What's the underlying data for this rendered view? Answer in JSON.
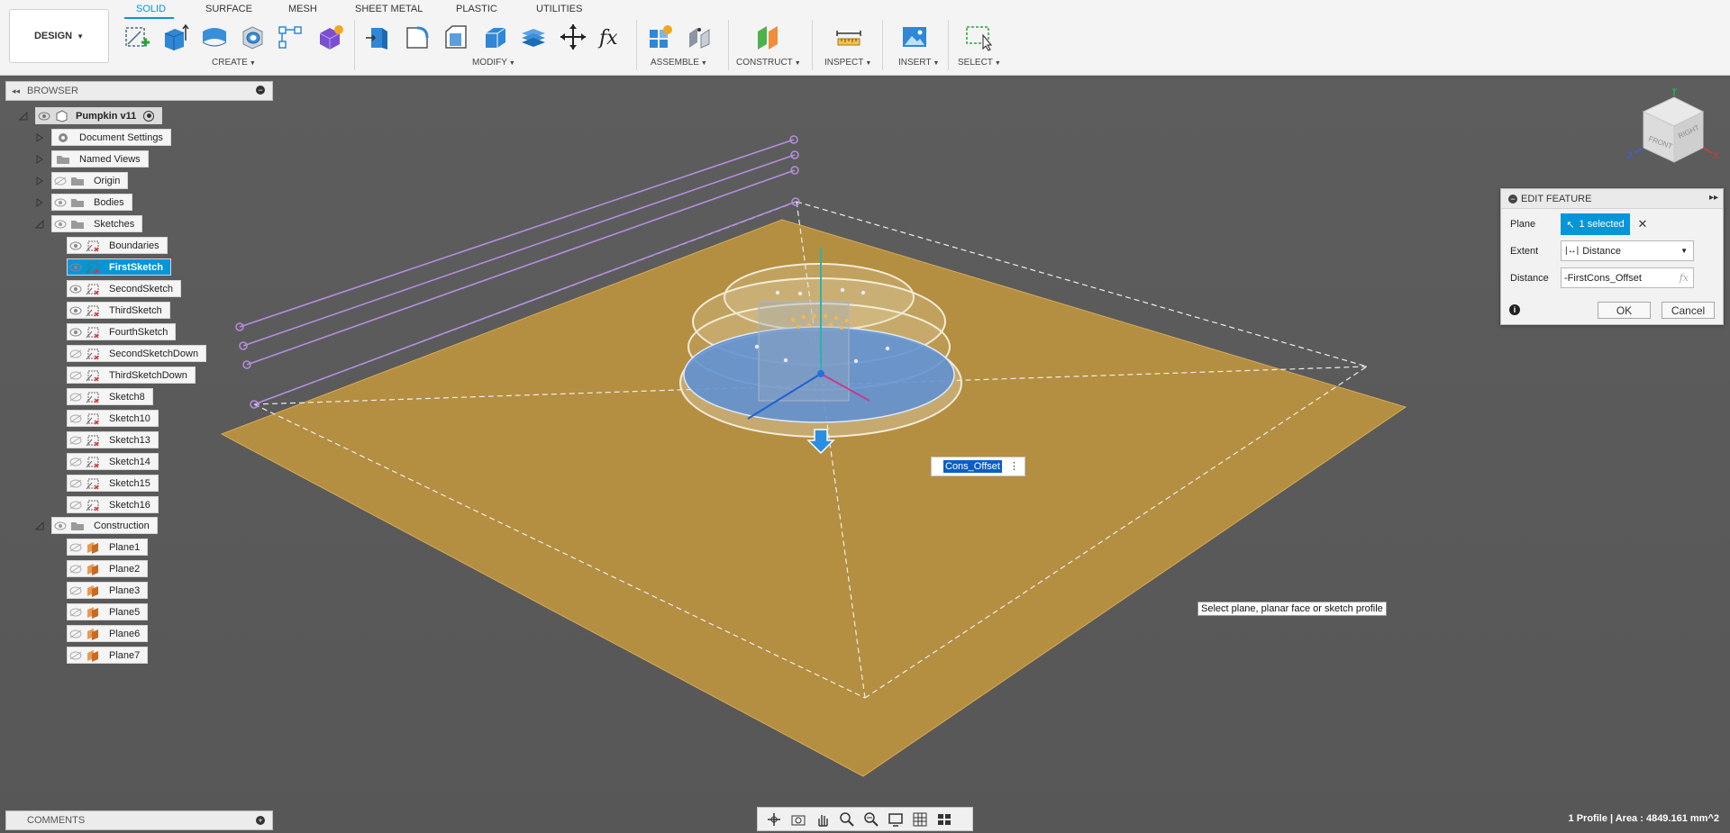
{
  "toolbar": {
    "workspace": "DESIGN",
    "tabs": [
      "SOLID",
      "SURFACE",
      "MESH",
      "SHEET METAL",
      "PLASTIC",
      "UTILITIES"
    ],
    "active_tab": "SOLID",
    "groups": {
      "create": "CREATE",
      "modify": "MODIFY",
      "assemble": "ASSEMBLE",
      "construct": "CONSTRUCT",
      "inspect": "INSPECT",
      "insert": "INSERT",
      "select": "SELECT"
    }
  },
  "browser": {
    "title": "BROWSER",
    "root": "Pumpkin v11",
    "items": [
      {
        "label": "Document Settings"
      },
      {
        "label": "Named Views"
      },
      {
        "label": "Origin"
      },
      {
        "label": "Bodies"
      },
      {
        "label": "Sketches"
      }
    ],
    "sketches": [
      "Boundaries",
      "FirstSketch",
      "SecondSketch",
      "ThirdSketch",
      "FourthSketch",
      "SecondSketchDown",
      "ThirdSketchDown",
      "Sketch8",
      "Sketch10",
      "Sketch13",
      "Sketch14",
      "Sketch15",
      "Sketch16"
    ],
    "selected_sketch": "FirstSketch",
    "construction": "Construction",
    "planes": [
      "Plane1",
      "Plane2",
      "Plane3",
      "Plane5",
      "Plane6",
      "Plane7"
    ]
  },
  "edit_feature": {
    "title": "EDIT FEATURE",
    "plane_label": "Plane",
    "plane_value": "1 selected",
    "extent_label": "Extent",
    "extent_value": "Distance",
    "distance_label": "Distance",
    "distance_value": "-FirstCons_Offset",
    "fx": "fx",
    "ok": "OK",
    "cancel": "Cancel"
  },
  "floating_input": {
    "value": "Cons_Offset"
  },
  "tooltip": "Select plane, planar face or sketch profile",
  "comments": {
    "title": "COMMENTS"
  },
  "status": "1 Profile | Area : 4849.161 mm^2",
  "viewcube": {
    "front": "FRONT",
    "right": "RIGHT",
    "axis_x": "X",
    "axis_y": "Y",
    "axis_z": "Z"
  },
  "colors": {
    "accent": "#0696d7",
    "plane_fill": "#c0953e",
    "sketch_lines": "#b58ee0",
    "profile_fill": "#5b8fd6"
  }
}
